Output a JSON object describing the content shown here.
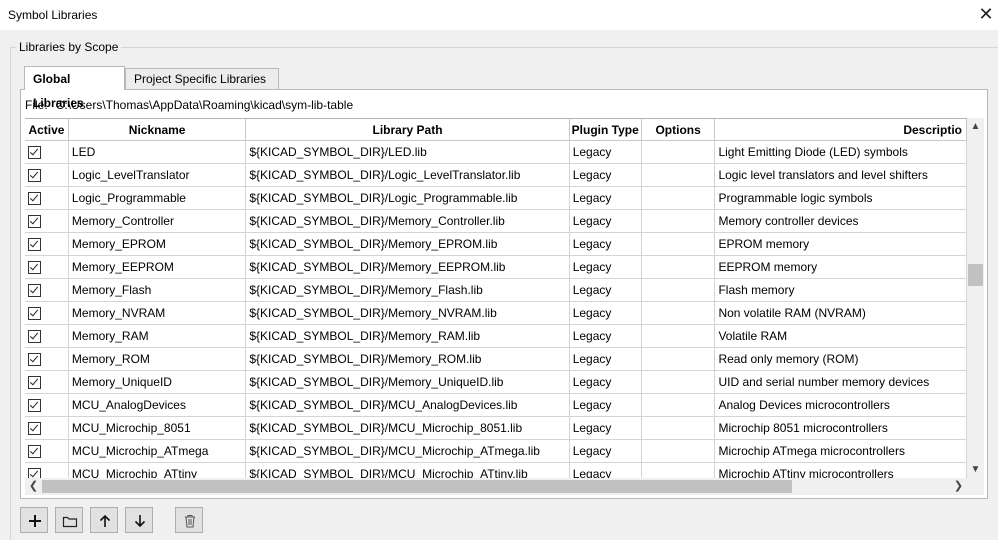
{
  "window": {
    "title": "Symbol Libraries",
    "close_glyph": "✕"
  },
  "group": {
    "label": "Libraries by Scope"
  },
  "tabs": [
    {
      "label": "Global Libraries",
      "active": true
    },
    {
      "label": "Project Specific Libraries",
      "active": false
    }
  ],
  "file": {
    "label": "File:",
    "path": "C:\\Users\\Thomas\\AppData\\Roaming\\kicad\\sym-lib-table"
  },
  "table": {
    "columns": [
      "Active",
      "Nickname",
      "Library Path",
      "Plugin Type",
      "Options",
      "Descriptio"
    ],
    "rows": [
      {
        "active": true,
        "nickname": "LED",
        "path": "${KICAD_SYMBOL_DIR}/LED.lib",
        "plugin": "Legacy",
        "options": "",
        "description": "Light Emitting Diode (LED) symbols"
      },
      {
        "active": true,
        "nickname": "Logic_LevelTranslator",
        "path": "${KICAD_SYMBOL_DIR}/Logic_LevelTranslator.lib",
        "plugin": "Legacy",
        "options": "",
        "description": "Logic level translators and level shifters"
      },
      {
        "active": true,
        "nickname": "Logic_Programmable",
        "path": "${KICAD_SYMBOL_DIR}/Logic_Programmable.lib",
        "plugin": "Legacy",
        "options": "",
        "description": "Programmable logic symbols"
      },
      {
        "active": true,
        "nickname": "Memory_Controller",
        "path": "${KICAD_SYMBOL_DIR}/Memory_Controller.lib",
        "plugin": "Legacy",
        "options": "",
        "description": "Memory controller devices"
      },
      {
        "active": true,
        "nickname": "Memory_EPROM",
        "path": "${KICAD_SYMBOL_DIR}/Memory_EPROM.lib",
        "plugin": "Legacy",
        "options": "",
        "description": "EPROM memory"
      },
      {
        "active": true,
        "nickname": "Memory_EEPROM",
        "path": "${KICAD_SYMBOL_DIR}/Memory_EEPROM.lib",
        "plugin": "Legacy",
        "options": "",
        "description": "EEPROM memory"
      },
      {
        "active": true,
        "nickname": "Memory_Flash",
        "path": "${KICAD_SYMBOL_DIR}/Memory_Flash.lib",
        "plugin": "Legacy",
        "options": "",
        "description": "Flash memory"
      },
      {
        "active": true,
        "nickname": "Memory_NVRAM",
        "path": "${KICAD_SYMBOL_DIR}/Memory_NVRAM.lib",
        "plugin": "Legacy",
        "options": "",
        "description": "Non volatile RAM (NVRAM)"
      },
      {
        "active": true,
        "nickname": "Memory_RAM",
        "path": "${KICAD_SYMBOL_DIR}/Memory_RAM.lib",
        "plugin": "Legacy",
        "options": "",
        "description": "Volatile RAM"
      },
      {
        "active": true,
        "nickname": "Memory_ROM",
        "path": "${KICAD_SYMBOL_DIR}/Memory_ROM.lib",
        "plugin": "Legacy",
        "options": "",
        "description": "Read only memory (ROM)"
      },
      {
        "active": true,
        "nickname": "Memory_UniqueID",
        "path": "${KICAD_SYMBOL_DIR}/Memory_UniqueID.lib",
        "plugin": "Legacy",
        "options": "",
        "description": "UID and serial number memory devices"
      },
      {
        "active": true,
        "nickname": "MCU_AnalogDevices",
        "path": "${KICAD_SYMBOL_DIR}/MCU_AnalogDevices.lib",
        "plugin": "Legacy",
        "options": "",
        "description": "Analog Devices microcontrollers"
      },
      {
        "active": true,
        "nickname": "MCU_Microchip_8051",
        "path": "${KICAD_SYMBOL_DIR}/MCU_Microchip_8051.lib",
        "plugin": "Legacy",
        "options": "",
        "description": "Microchip 8051 microcontrollers"
      },
      {
        "active": true,
        "nickname": "MCU_Microchip_ATmega",
        "path": "${KICAD_SYMBOL_DIR}/MCU_Microchip_ATmega.lib",
        "plugin": "Legacy",
        "options": "",
        "description": "Microchip ATmega microcontrollers"
      },
      {
        "active": true,
        "nickname": "MCU_Microchip_ATtiny",
        "path": "${KICAD_SYMBOL_DIR}/MCU_Microchip_ATtiny.lib",
        "plugin": "Legacy",
        "options": "",
        "description": "Microchip ATtiny microcontrollers"
      }
    ]
  },
  "toolbar": {
    "buttons": [
      {
        "icon": "plus-icon"
      },
      {
        "icon": "folder-icon"
      },
      {
        "icon": "arrow-up-icon"
      },
      {
        "icon": "arrow-down-icon"
      },
      {
        "icon": "trash-icon"
      }
    ]
  }
}
